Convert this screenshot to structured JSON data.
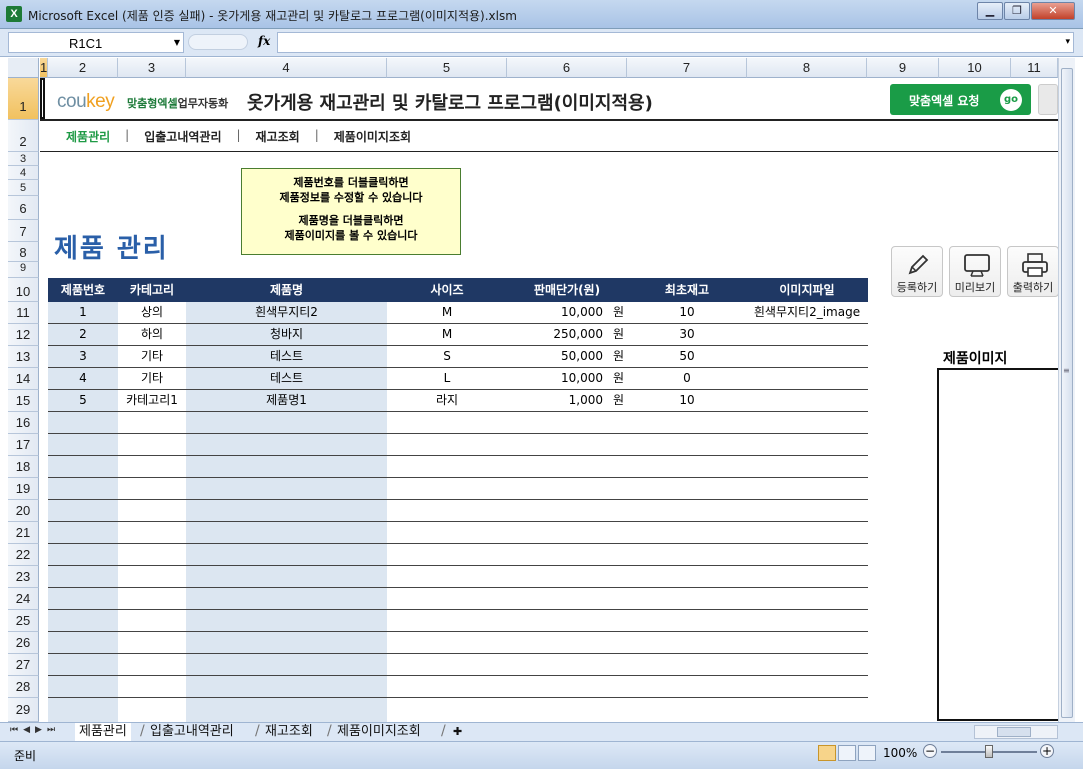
{
  "window": {
    "title": "Microsoft Excel (제품 인증 실패) - 옷가게용 재고관리 및 카탈로그 프로그램(이미지적용).xlsm",
    "app_icon": "X"
  },
  "formula_bar": {
    "name_box": "R1C1",
    "fx": "fx",
    "formula": ""
  },
  "columns": [
    "1",
    "2",
    "3",
    "4",
    "5",
    "6",
    "7",
    "8",
    "9",
    "10",
    "11"
  ],
  "rows": [
    "1",
    "2",
    "3",
    "4",
    "5",
    "6",
    "7",
    "8",
    "9",
    "10",
    "11",
    "12",
    "13",
    "14",
    "15",
    "16",
    "17",
    "18",
    "19",
    "20",
    "21",
    "22",
    "23",
    "24",
    "25",
    "26",
    "27",
    "28",
    "29"
  ],
  "banner": {
    "logo_main": "cou",
    "logo_accent": "key",
    "logo_sub_green": "맞춤형엑셀",
    "logo_sub_dark": "업무자동화",
    "title": "옷가게용 재고관리 및 카탈로그 프로그램(이미지적용)",
    "order_button": "맞춤엑셀 요청",
    "order_go": "go"
  },
  "nav": {
    "items": [
      "제품관리",
      "입출고내역관리",
      "재고조회",
      "제품이미지조회"
    ],
    "separator": "|"
  },
  "note": {
    "line1": "제품번호를 더블클릭하면",
    "line2": "제품정보를 수정할 수 있습니다",
    "line3": "제품명을 더블클릭하면",
    "line4": "제품이미지를 볼 수 있습니다"
  },
  "page_heading": "제품 관리",
  "tools": {
    "register": "등록하기",
    "preview": "미리보기",
    "print": "출력하기"
  },
  "table": {
    "headers": [
      "제품번호",
      "카테고리",
      "제품명",
      "사이즈",
      "판매단가(원)",
      "최초재고",
      "이미지파일"
    ],
    "currency_unit": "원",
    "rows": [
      {
        "no": "1",
        "category": "상의",
        "name": "흰색무지티2",
        "size": "M",
        "price": "10,000",
        "stock": "10",
        "image": "흰색무지티2_image"
      },
      {
        "no": "2",
        "category": "하의",
        "name": "청바지",
        "size": "M",
        "price": "250,000",
        "stock": "30",
        "image": ""
      },
      {
        "no": "3",
        "category": "기타",
        "name": "테스트",
        "size": "S",
        "price": "50,000",
        "stock": "50",
        "image": ""
      },
      {
        "no": "4",
        "category": "기타",
        "name": "테스트",
        "size": "L",
        "price": "10,000",
        "stock": "0",
        "image": ""
      },
      {
        "no": "5",
        "category": "카테고리1",
        "name": "제품명1",
        "size": "라지",
        "price": "1,000",
        "stock": "10",
        "image": ""
      }
    ]
  },
  "image_panel": {
    "label": "제품이미지"
  },
  "sheet_tabs": [
    "제품관리",
    "입출고내역관리",
    "재고조회",
    "제품이미지조회"
  ],
  "status": {
    "ready": "준비",
    "zoom": "100%"
  },
  "colors": {
    "header_bg": "#1f3864",
    "accent_green": "#1a9c47",
    "heading_blue": "#2a5fa8",
    "note_bg": "#ffffcc",
    "shade": "#dce6f1"
  }
}
